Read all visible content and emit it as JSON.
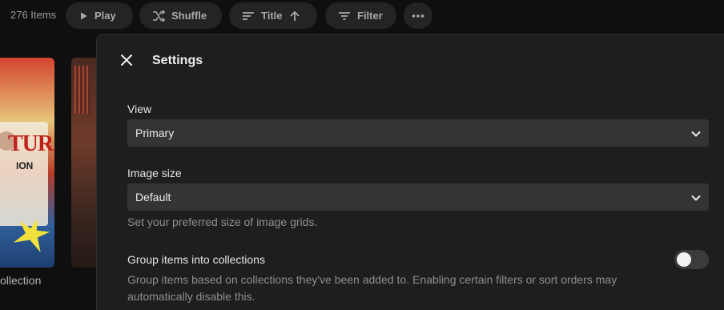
{
  "toolbar": {
    "item_count": "276 Items",
    "play_label": "Play",
    "shuffle_label": "Shuffle",
    "sort_label": "Title",
    "filter_label": "Filter"
  },
  "background": {
    "poster_title": "TURA",
    "poster_subtitle": "ION",
    "caption": "ollection"
  },
  "settings": {
    "title": "Settings",
    "view": {
      "label": "View",
      "value": "Primary"
    },
    "image_size": {
      "label": "Image size",
      "value": "Default",
      "hint": "Set your preferred size of image grids."
    },
    "group_collections": {
      "label": "Group items into collections",
      "hint_line1": "Group items based on collections they've been added to. Enabling certain filters or sort orders may",
      "hint_line2": "automatically disable this.",
      "enabled": false
    }
  },
  "colors": {
    "background": "#0f0f10",
    "panel": "#1e1e20",
    "select_bg": "#343437",
    "toolbar_button": "#242426"
  }
}
